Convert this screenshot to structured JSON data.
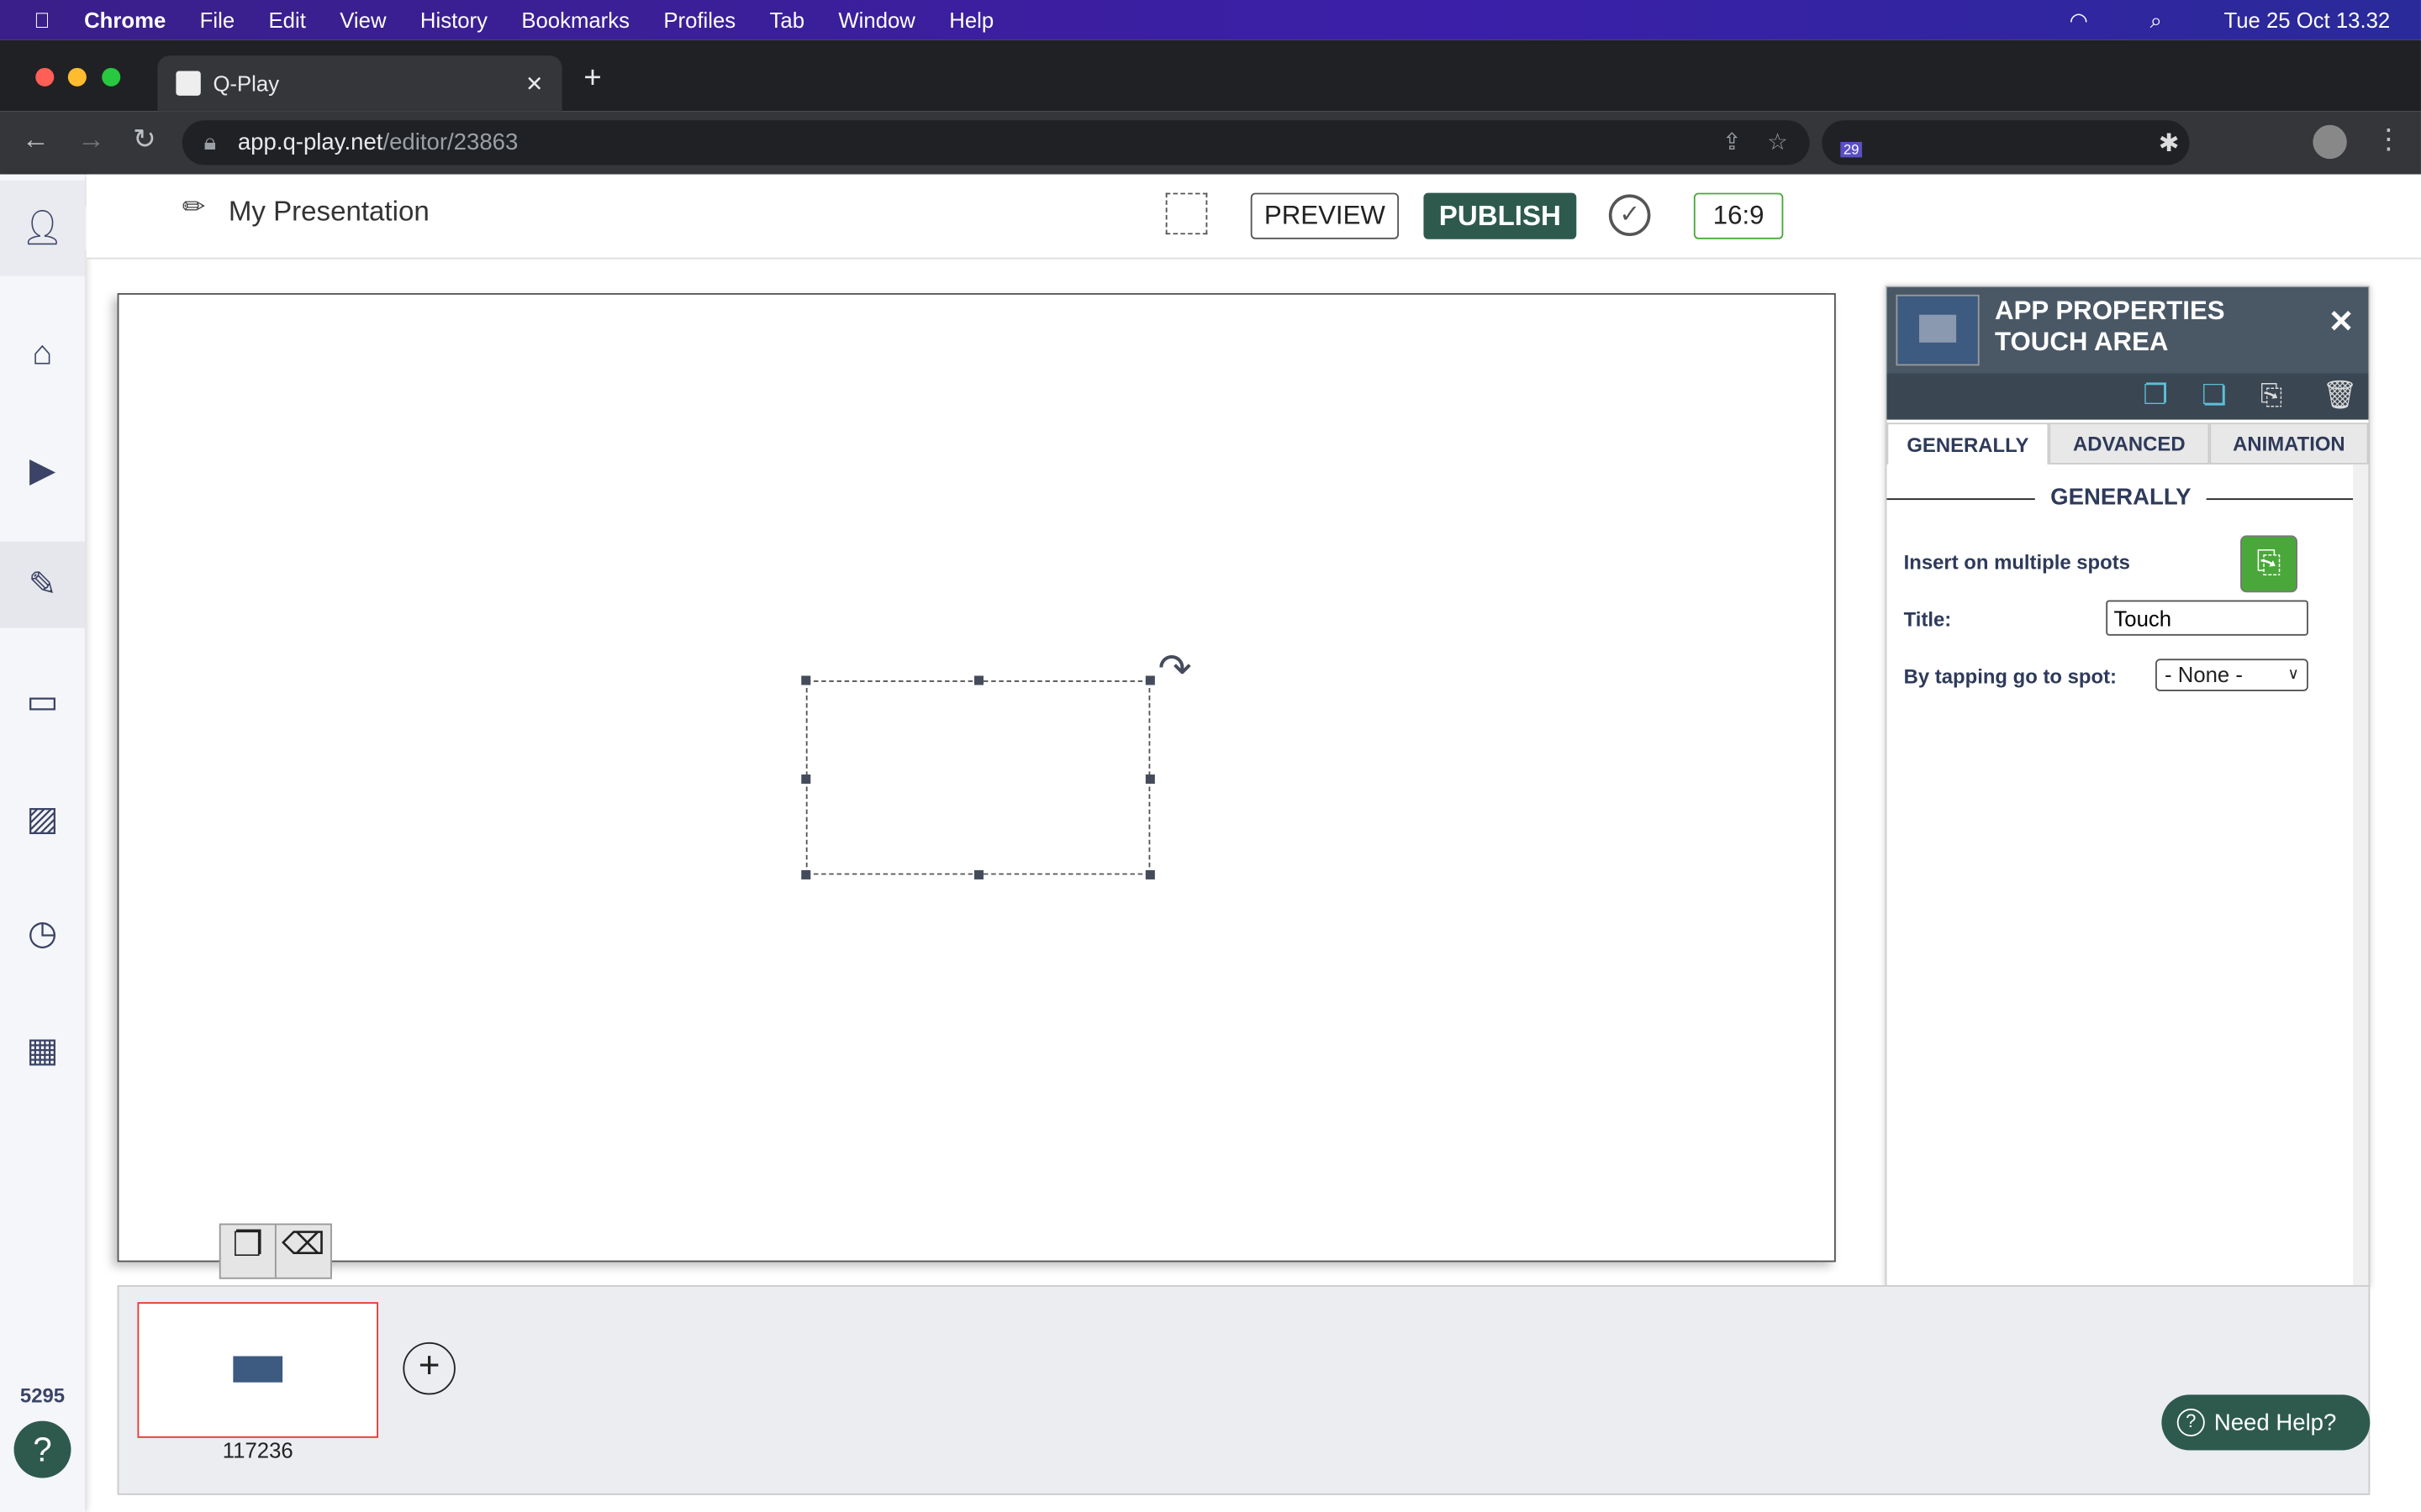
{
  "menubar": {
    "app": "Chrome",
    "items": [
      "File",
      "Edit",
      "View",
      "History",
      "Bookmarks",
      "Profiles",
      "Tab",
      "Window",
      "Help"
    ],
    "clock": "Tue 25 Oct  13.32"
  },
  "browser": {
    "tab_title": "Q-Play",
    "url_host": "app.q-play.net",
    "url_path": "/editor/23863",
    "ext_badge": "29"
  },
  "editor": {
    "title": "My Presentation",
    "preview": "PREVIEW",
    "publish": "PUBLISH",
    "aspect": "16:9",
    "expand": ">"
  },
  "sidebar": {
    "items": [
      "user-settings",
      "home",
      "media",
      "editor",
      "screens",
      "images",
      "schedule",
      "calendar"
    ],
    "count": "5295"
  },
  "panel": {
    "title1": "APP PROPERTIES",
    "title2": "TOUCH AREA",
    "tabs": [
      "GENERALLY",
      "ADVANCED",
      "ANIMATION"
    ],
    "section": "GENERALLY",
    "insert_label": "Insert on multiple spots",
    "title_label": "Title:",
    "title_value": "Touch",
    "goto_label": "By tapping go to spot:",
    "goto_value": "- None -"
  },
  "slides": [
    {
      "id": "117236"
    }
  ],
  "help": "Need Help?",
  "colors": {
    "publish": "#2e5a4e",
    "panel_header": "#4a5866",
    "accent_green": "#4aa83a"
  }
}
